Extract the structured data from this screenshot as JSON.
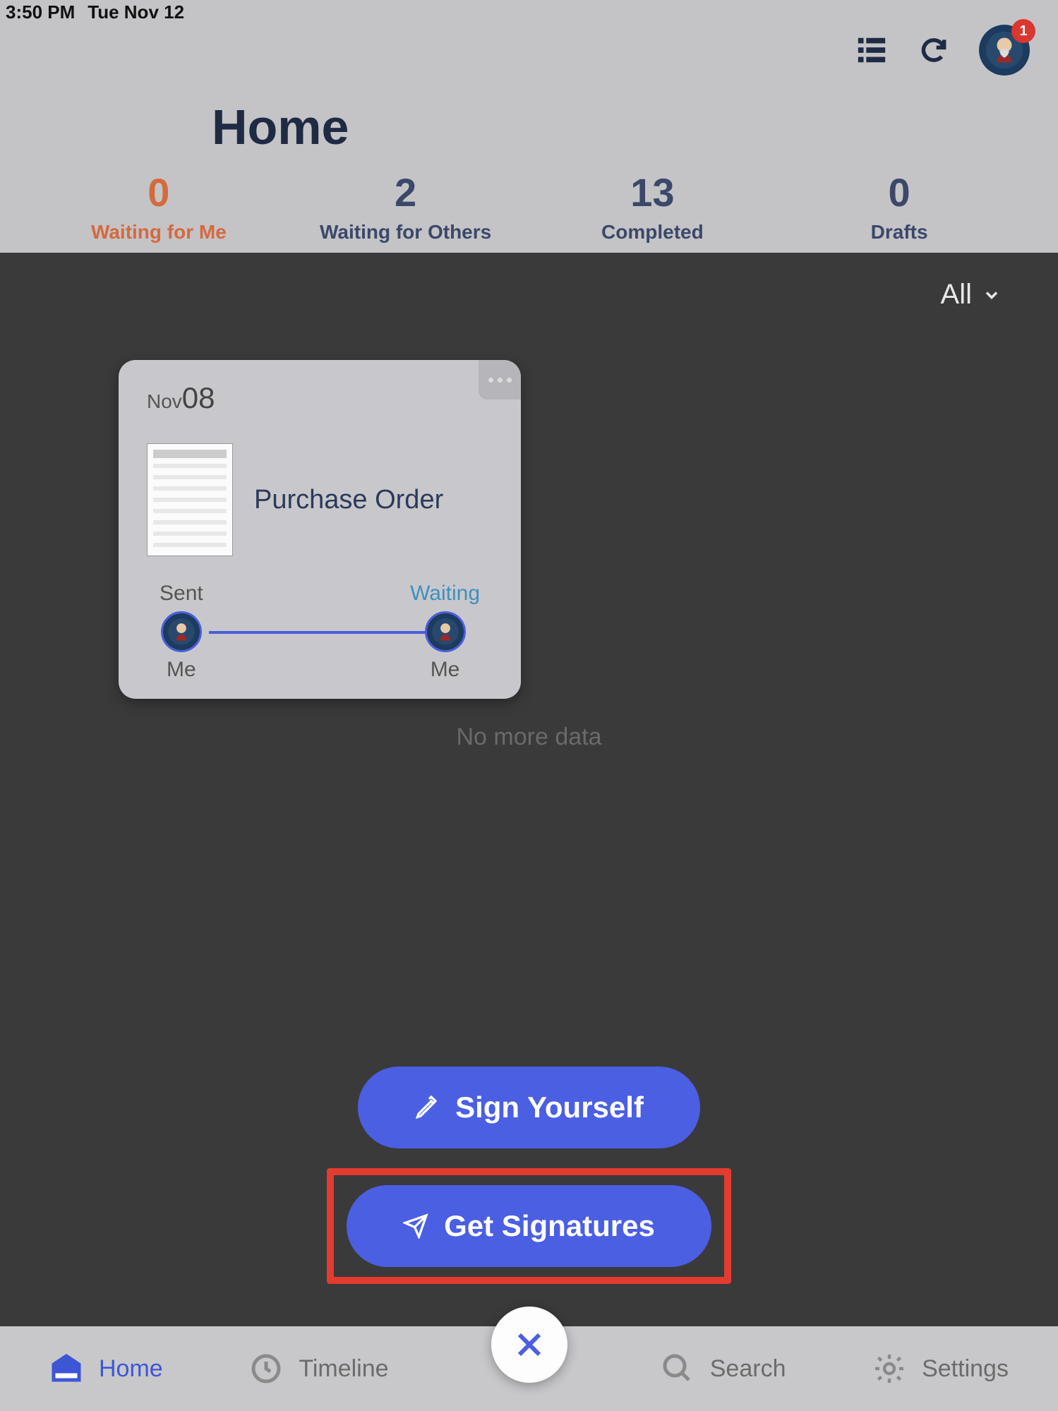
{
  "statusbar": {
    "time": "3:50 PM",
    "date": "Tue Nov 12"
  },
  "header": {
    "title": "Home",
    "notification_count": "1"
  },
  "tabs": [
    {
      "count": "0",
      "label": "Waiting for Me",
      "active": true
    },
    {
      "count": "2",
      "label": "Waiting for Others",
      "active": false
    },
    {
      "count": "13",
      "label": "Completed",
      "active": false
    },
    {
      "count": "0",
      "label": "Drafts",
      "active": false
    }
  ],
  "filter": {
    "label": "All"
  },
  "card": {
    "date_month": "Nov",
    "date_day": "08",
    "title": "Purchase Order",
    "from": {
      "status": "Sent",
      "who": "Me"
    },
    "to": {
      "status": "Waiting",
      "who": "Me"
    }
  },
  "list_footer": "No more data",
  "actions": {
    "sign_yourself": "Sign Yourself",
    "get_signatures": "Get Signatures"
  },
  "bottomnav": {
    "home": "Home",
    "timeline": "Timeline",
    "search": "Search",
    "settings": "Settings"
  }
}
